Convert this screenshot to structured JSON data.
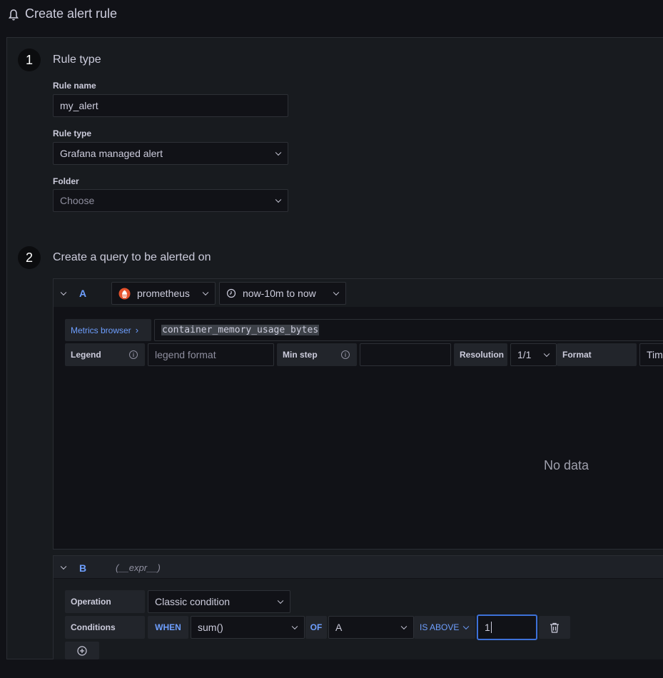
{
  "header": {
    "title": "Create alert rule",
    "icon": "bell-icon"
  },
  "section1": {
    "number": "1",
    "title": "Rule type",
    "rule_name_label": "Rule name",
    "rule_name_value": "my_alert",
    "rule_type_label": "Rule type",
    "rule_type_value": "Grafana managed alert",
    "folder_label": "Folder",
    "folder_placeholder": "Choose"
  },
  "section2": {
    "number": "2",
    "title": "Create a query to be alerted on",
    "query_a": {
      "ref": "A",
      "datasource": "prometheus",
      "time_range": "now-10m to now",
      "metrics_browser": "Metrics browser",
      "query": "container_memory_usage_bytes",
      "legend_label": "Legend",
      "legend_placeholder": "legend format",
      "min_step_label": "Min step",
      "min_step_value": "",
      "resolution_label": "Resolution",
      "resolution_value": "1/1",
      "format_label": "Format",
      "format_value": "Tim",
      "no_data": "No data"
    },
    "query_b": {
      "ref": "B",
      "expr": "(__expr__)",
      "operation_label": "Operation",
      "operation_value": "Classic condition",
      "conditions_label": "Conditions",
      "when": "WHEN",
      "reducer": "sum()",
      "of": "OF",
      "query_ref": "A",
      "evaluator": "IS ABOVE",
      "threshold": "1"
    }
  },
  "colors": {
    "accent": "#6e9fff",
    "background": "#111217",
    "panel": "#181b1f"
  }
}
